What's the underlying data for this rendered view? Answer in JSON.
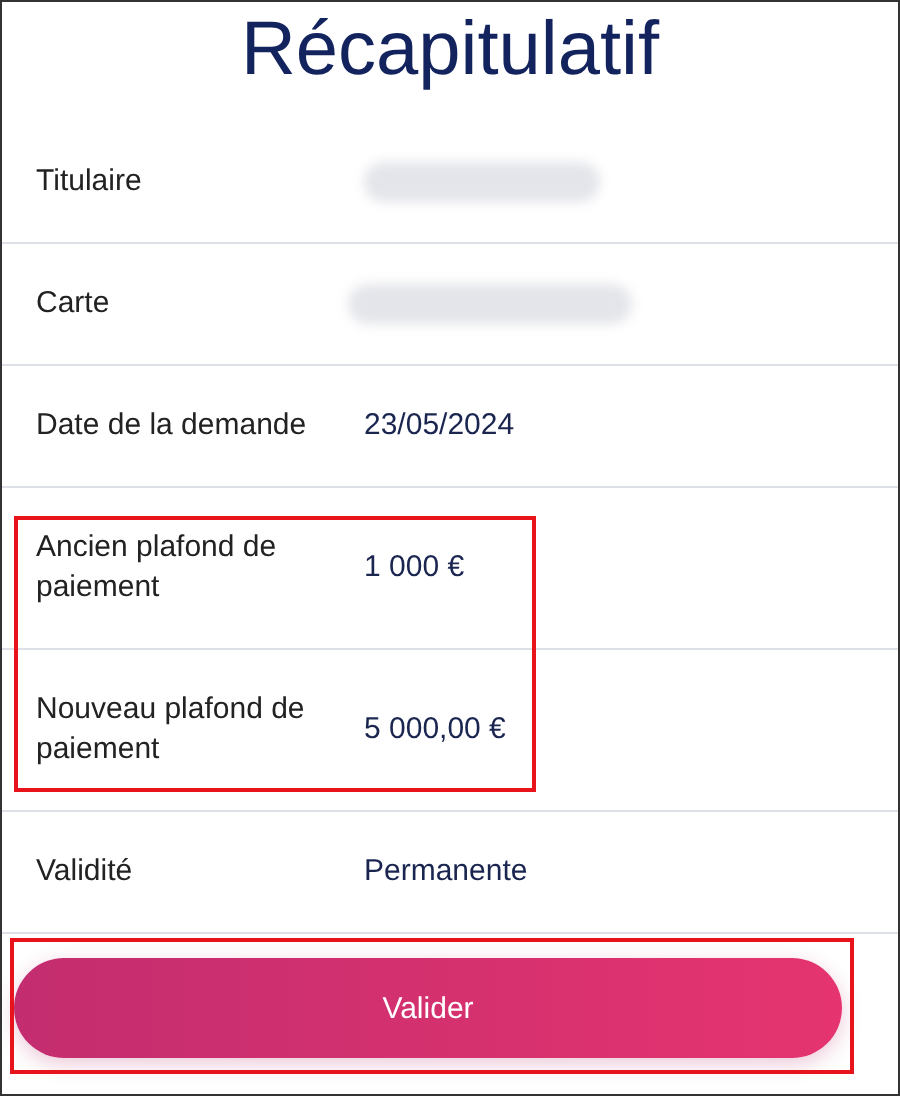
{
  "title": "Récapitulatif",
  "rows": [
    {
      "label": "Titulaire",
      "kind": "redacted",
      "highlighted": false
    },
    {
      "label": "Carte",
      "kind": "redacted",
      "highlighted": false
    },
    {
      "label": "Date de la demande",
      "kind": "text",
      "value": "23/05/2024",
      "highlighted": false
    },
    {
      "label": "Ancien plafond de paiement",
      "kind": "text",
      "value": "1 000 €",
      "highlighted": true
    },
    {
      "label": "Nouveau plafond de paiement",
      "kind": "text",
      "value": "5 000,00 €",
      "highlighted": true
    },
    {
      "label": "Validité",
      "kind": "text",
      "value": "Permanente",
      "highlighted": false
    }
  ],
  "button": {
    "label": "Valider",
    "highlighted": true
  }
}
